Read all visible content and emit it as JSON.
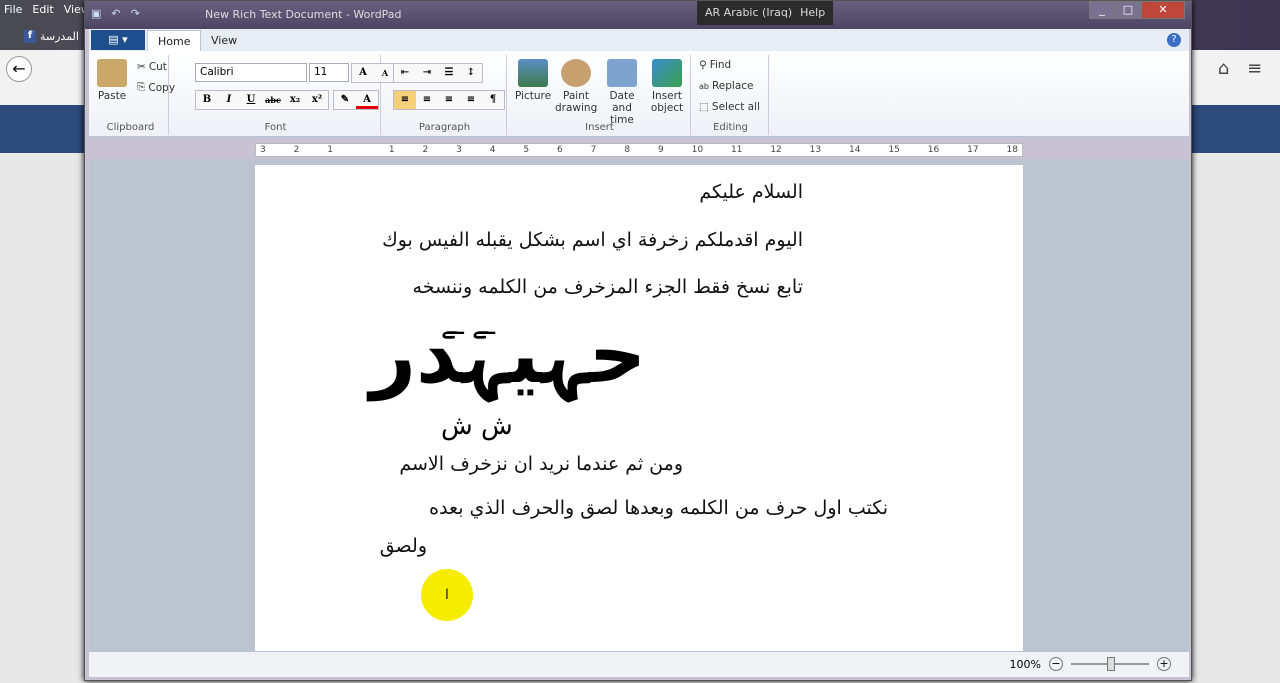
{
  "background": {
    "menu": [
      "File",
      "Edit",
      "View"
    ],
    "fb_text": "المدرسة"
  },
  "window": {
    "title": "New Rich Text Document - WordPad",
    "language": "AR Arabic (Iraq)",
    "help": "Help"
  },
  "tabs": [
    {
      "label": "Home",
      "active": true
    },
    {
      "label": "View",
      "active": false
    }
  ],
  "ribbon": {
    "clipboard": {
      "label": "Clipboard",
      "paste": "Paste",
      "cut": "Cut",
      "copy": "Copy"
    },
    "font": {
      "label": "Font",
      "family": "Calibri",
      "size": "11",
      "buttons": [
        "B",
        "I",
        "U",
        "abc",
        "x₂",
        "x²"
      ]
    },
    "paragraph": {
      "label": "Paragraph"
    },
    "insert": {
      "label": "Insert",
      "picture": "Picture",
      "paint": "Paint drawing",
      "datetime": "Date and time",
      "object": "Insert object"
    },
    "editing": {
      "label": "Editing",
      "find": "Find",
      "replace": "Replace",
      "select_all": "Select all"
    }
  },
  "ruler": [
    "3",
    "2",
    "1",
    "",
    "1",
    "2",
    "3",
    "4",
    "5",
    "6",
    "7",
    "8",
    "9",
    "10",
    "11",
    "12",
    "13",
    "14",
    "15",
    "16",
    "17",
    "18"
  ],
  "document": {
    "lines": [
      "السلام عليكم",
      "اليوم اقدملكم زخرفة اي اسم بشكل يقبله الفيس بوك",
      "تابع نسخ فقط الجزء المزخرف من الكلمه وننسخه",
      "ومن ثم عندما نريد ان نزخرف الاسم",
      "نكتب اول حرف من الكلمه وبعدها لصق والحرف الذي بعده",
      "ولصق"
    ],
    "decorated": "حہيہدر",
    "marks_above": "ـے ـے",
    "marks_below": "ش ش"
  },
  "status": {
    "zoom": "100%",
    "zoom_level": 100
  },
  "colors": {
    "file_tab": "#1f4e8c",
    "highlight": "#f5ec00",
    "font_color": "#e00000"
  }
}
